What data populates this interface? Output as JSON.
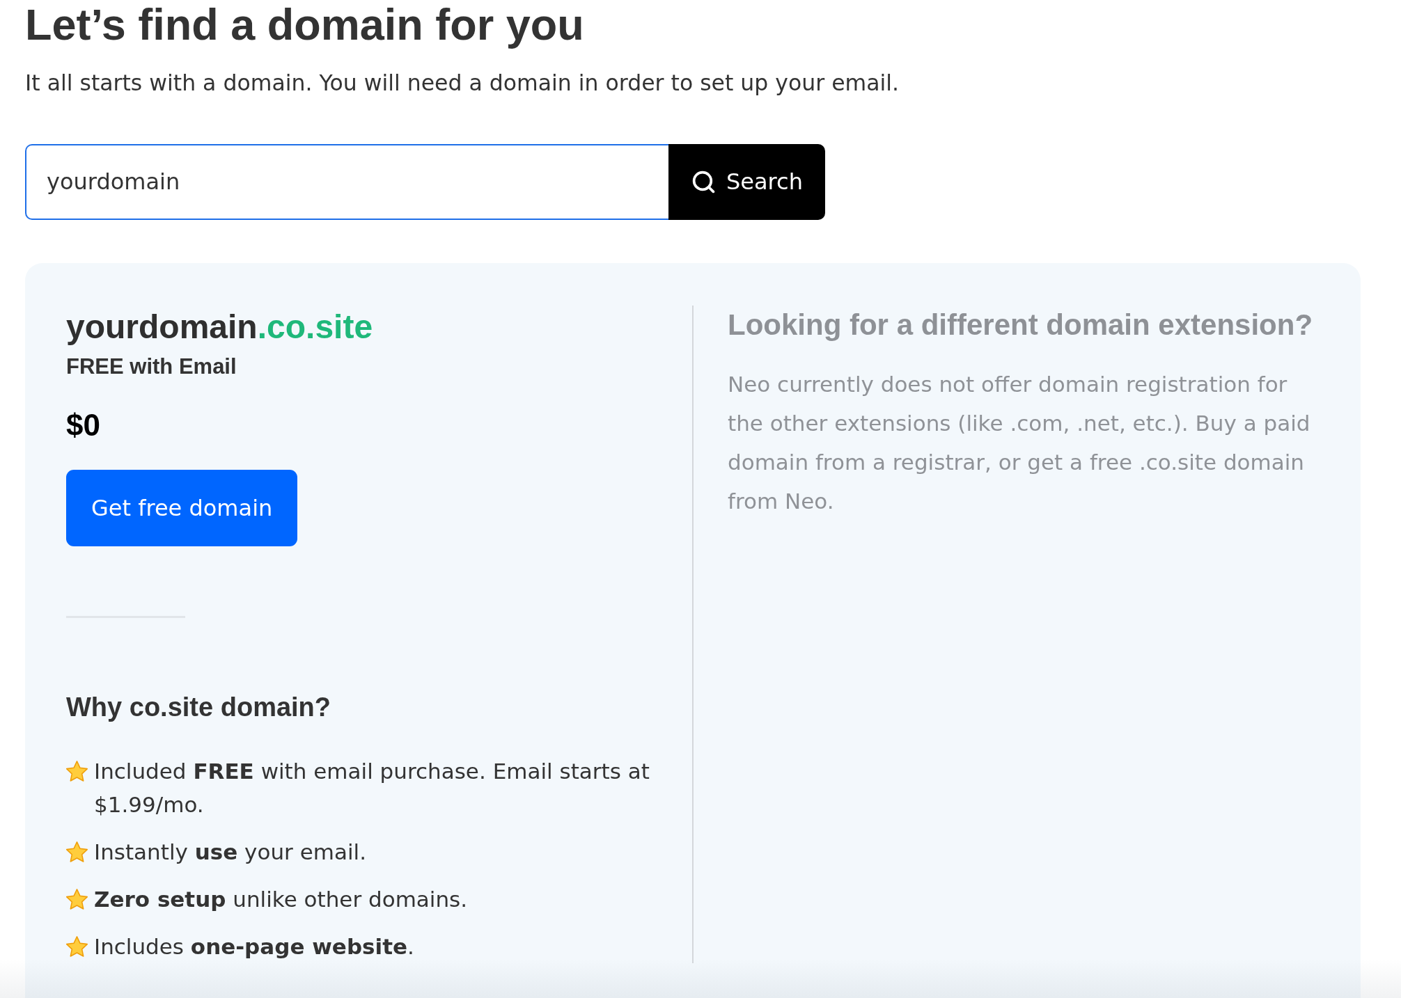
{
  "page": {
    "title": "Let’s find a domain for you",
    "subtitle": "It all starts with a domain. You will need a domain in order to set up your email."
  },
  "search": {
    "value": "yourdomain",
    "focused": true,
    "button": "Search"
  },
  "result": {
    "domain_name": "yourdomain",
    "domain_extension": ".co.site",
    "tagline": "FREE with Email",
    "price": "$0",
    "button": "Get free domain",
    "benefits_title": "Why co.site domain?",
    "benefits": [
      "Included **FREE** with email purchase. Email starts at $1.99/mo.",
      "Instantly **use** your email.",
      "**Zero setup** unlike other domains.",
      "Includes **one-page website**."
    ]
  },
  "other_extensions": {
    "title": "Looking for a different domain extension?",
    "text": "Neo currently does not offer domain registration for the other extensions (like .com, .net, etc.). Buy a paid domain from a registrar, or get a free .co.site domain from Neo."
  }
}
